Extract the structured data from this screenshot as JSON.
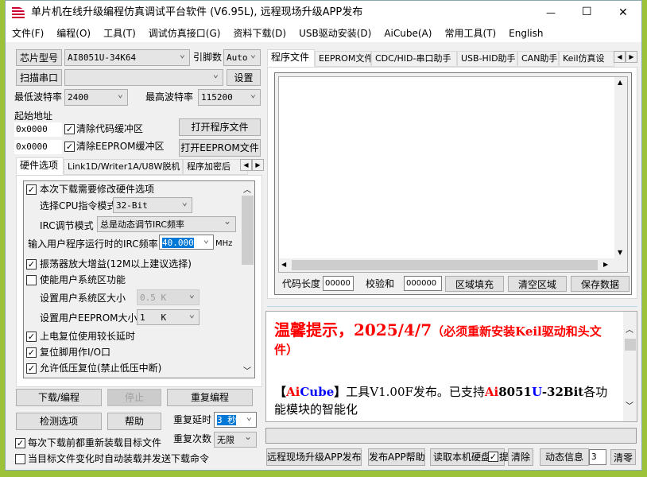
{
  "window": {
    "title": "单片机在线升级编程仿真调试平台软件 (V6.95L), 远程现场升级APP发布",
    "minimize": "—",
    "maximize": "☐",
    "close": "✕"
  },
  "menu": [
    "文件(F)",
    "编程(O)",
    "工具(T)",
    "调试仿真接口(G)",
    "资料下载(D)",
    "USB驱动安装(D)",
    "AiCube(A)",
    "常用工具(T)",
    "English"
  ],
  "left": {
    "chip_btn": "芯片型号",
    "chip_value": "AI8051U-34K64",
    "pins_label": "引脚数",
    "pins_value": "Auto",
    "scan_btn": "扫描串口",
    "port_value": "",
    "settings_btn": "设置",
    "min_baud_label": "最低波特率",
    "min_baud": "2400",
    "max_baud_label": "最高波特率",
    "max_baud": "115200",
    "start_addr_label": "起始地址",
    "addr1": "0x0000",
    "addr2": "0x0000",
    "clear_code": "清除代码缓冲区",
    "clear_eeprom": "清除EEPROM缓冲区",
    "open_prog": "打开程序文件",
    "open_eeprom": "打开EEPROM文件",
    "tabs": [
      "硬件选项",
      "Link1D/Writer1A/U8W脱机",
      "程序加密后"
    ],
    "hw": {
      "modify": "本次下载需要修改硬件选项",
      "cpu_mode_label": "选择CPU指令模式",
      "cpu_mode": "32-Bit",
      "irc_mode_label": "IRC调节模式",
      "irc_mode": "总是动态调节IRC频率",
      "irc_freq_label": "输入用户程序运行时的IRC频率",
      "irc_freq": "40.000",
      "mhz": "MHz",
      "osc_gain": "振荡器放大增益(12M以上建议选择)",
      "user_sys": "使能用户系统区功能",
      "user_sys_size_label": "设置用户系统区大小",
      "user_sys_size": "0.5 K",
      "user_eeprom_label": "设置用户EEPROM大小",
      "user_eeprom": "1   K",
      "long_delay": "上电复位使用较长延时",
      "reset_io": "复位脚用作I/O口",
      "lvr": "允许低压复位(禁止低压中断)"
    },
    "download": "下载/编程",
    "stop": "停止",
    "repeat": "重复编程",
    "detect": "检测选项",
    "help": "帮助",
    "repeat_delay_label": "重复延时",
    "repeat_delay": "3 秒",
    "repeat_count_label": "重复次数",
    "repeat_count": "无限",
    "reload": "每次下载前都重新装载目标文件",
    "auto_load": "当目标文件变化时自动装载并发送下载命令"
  },
  "right": {
    "tabs": [
      "程序文件",
      "EEPROM文件",
      "CDC/HID-串口助手",
      "USB-HID助手",
      "CAN助手",
      "Keil仿真设"
    ],
    "code_len_label": "代码长度",
    "code_len": "00000",
    "checksum_label": "校验和",
    "checksum": "000000",
    "fill": "区域填充",
    "clear_area": "清空区域",
    "save": "保存数据",
    "notice_title": "温馨提示，2025/4/7",
    "notice_paren": "（必须重新安装Keil驱动和头文件）",
    "news": {
      "lb": "【",
      "ai": "Ai",
      "cube": "Cube",
      "rb": "】",
      "t1": "工具V1.00F发布。已支持",
      "ai2": "Ai",
      "n8051": "8051",
      "u": "U",
      "bit": "-32Bit",
      "t2": "各功能模块的智能化"
    },
    "bottom": {
      "remote": "远程现场升级APP发布",
      "publish_help": "发布APP帮助",
      "read_disk": "读取本机硬盘",
      "hint": "提",
      "clear": "清除",
      "dyn": "动态信息",
      "count": "3",
      "reset": "清零"
    }
  },
  "colors": {
    "accent_red": "#ff0000",
    "accent_blue": "#0000ff",
    "selection": "#0078d7"
  }
}
